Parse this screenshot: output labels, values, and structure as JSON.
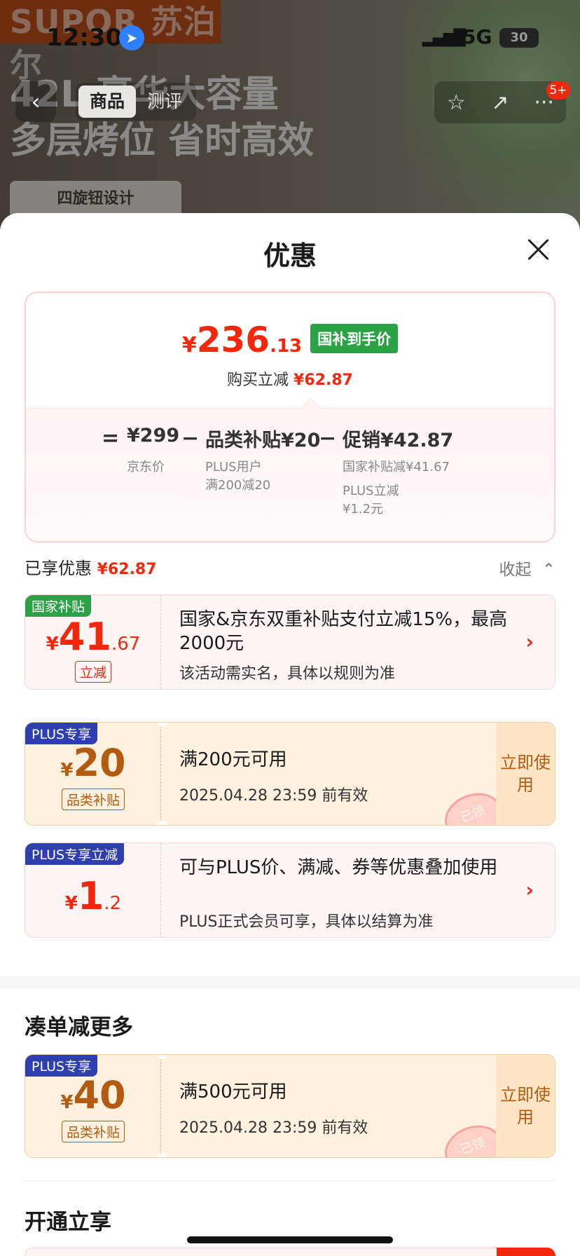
{
  "status_bar": {
    "time": "12:30",
    "network": "5G",
    "battery": "30"
  },
  "background": {
    "brand": "SUPOR 苏泊尔",
    "headline_1": "42L 豪华大容量",
    "headline_2": "多层烤位 省时高效",
    "feature_pill": "四旋钮设计"
  },
  "nav": {
    "tabs": [
      {
        "label": "商品"
      },
      {
        "label": "测评"
      }
    ],
    "badge": "5+"
  },
  "sheet": {
    "title": "优惠",
    "final_price": {
      "currency": "¥",
      "integer": "236",
      "decimal": ".13",
      "tag": "国补到手价"
    },
    "save": {
      "label": "购买立减",
      "amount": "¥62.87"
    },
    "breakdown": {
      "eq": "=",
      "jd_price": "¥299",
      "jd_label": "京东价",
      "minus": "−",
      "category_sub": "品类补贴¥20",
      "category_note_1": "PLUS用户",
      "category_note_2": "满200减20",
      "promo": "促销¥42.87",
      "promo_note_1": "国家补贴减¥41.67",
      "promo_note_2": "PLUS立减",
      "promo_note_3": "¥1.2元"
    },
    "enjoyed": {
      "label": "已享优惠",
      "amount": "¥62.87",
      "collapse": "收起"
    },
    "coupons": [
      {
        "ribbon": "国家补贴",
        "currency": "¥",
        "integer": "41",
        "decimal": ".67",
        "tag": "立减",
        "title": "国家&京东双重补贴支付立减15%，最高2000元",
        "desc": "该活动需实名，具体以规则为准"
      },
      {
        "ribbon": "PLUS专享",
        "currency": "¥",
        "integer": "20",
        "tag": "品类补贴",
        "title": "满200元可用",
        "desc": "2025.04.28 23:59 前有效",
        "action": "立即使用",
        "stamp": "已领"
      },
      {
        "ribbon": "PLUS专享立减",
        "currency": "¥",
        "integer": "1",
        "decimal": ".2",
        "title": "可与PLUS价、满减、券等优惠叠加使用",
        "desc": "PLUS正式会员可享，具体以结算为准"
      }
    ],
    "more_section": {
      "title": "凑单减更多",
      "coupon": {
        "ribbon": "PLUS专享",
        "currency": "¥",
        "integer": "40",
        "tag": "品类补贴",
        "title": "满500元可用",
        "desc": "2025.04.28 23:59 前有效",
        "action": "立即使用",
        "stamp": "已领"
      }
    },
    "open_section": {
      "title": "开通立享"
    }
  }
}
